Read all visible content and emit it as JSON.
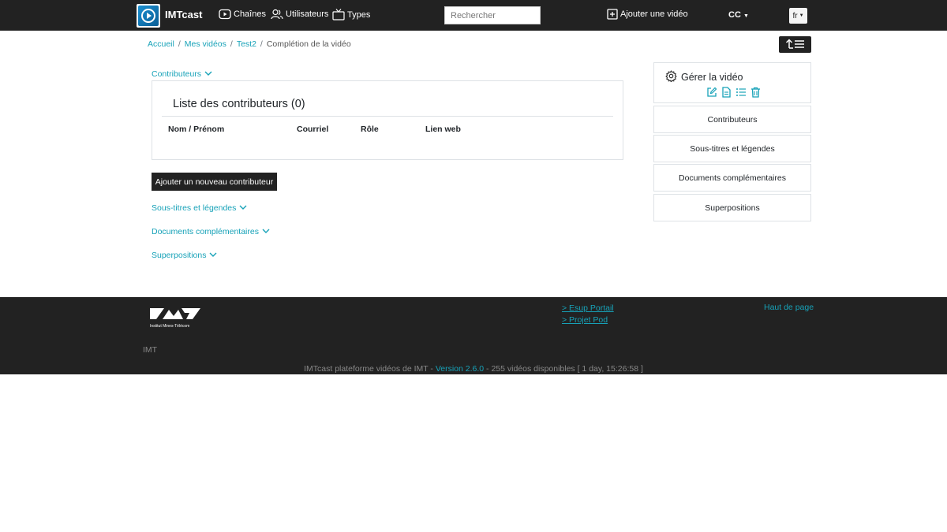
{
  "navbar": {
    "brand": "IMTcast",
    "links": [
      {
        "label": "Chaînes",
        "icon": "tv-play-icon"
      },
      {
        "label": "Utilisateurs",
        "icon": "users-icon"
      },
      {
        "label": "Types",
        "icon": "tv-icon"
      }
    ],
    "search_placeholder": "Rechercher",
    "add_video": "Ajouter une vidéo",
    "cc": "CC",
    "lang": "fr"
  },
  "breadcrumb": {
    "items": [
      "Accueil",
      "Mes vidéos",
      "Test2"
    ],
    "current": "Complétion de la vidéo"
  },
  "main": {
    "contributors_toggle": "Contributeurs",
    "card_title": "Liste des contributeurs (0)",
    "columns": [
      "Nom / Prénom",
      "Courriel",
      "Rôle",
      "Lien web"
    ],
    "add_button": "Ajouter un nouveau contributeur",
    "sections": [
      "Sous-titres et légendes",
      "Documents complémentaires",
      "Superpositions"
    ]
  },
  "sidebar": {
    "manage_title": "Gérer la vidéo",
    "icons": [
      "edit-icon",
      "document-icon",
      "list-icon",
      "trash-icon"
    ],
    "items": [
      "Contributeurs",
      "Sous-titres et légendes",
      "Documents complémentaires",
      "Superpositions"
    ]
  },
  "footer": {
    "logo_caption": "Institut Mines-Télécom",
    "imt": "IMT",
    "links": [
      "> Esup Portail",
      "> Projet Pod"
    ],
    "top_link": "Haut de page",
    "bottom_prefix": "IMTcast plateforme vidéos de IMT - ",
    "version": "Version 2.6.0",
    "bottom_suffix": " - 255 vidéos disponibles [ 1 day, 15:26:58 ]"
  },
  "colors": {
    "accent": "#17a2b8",
    "dark": "#222222"
  }
}
